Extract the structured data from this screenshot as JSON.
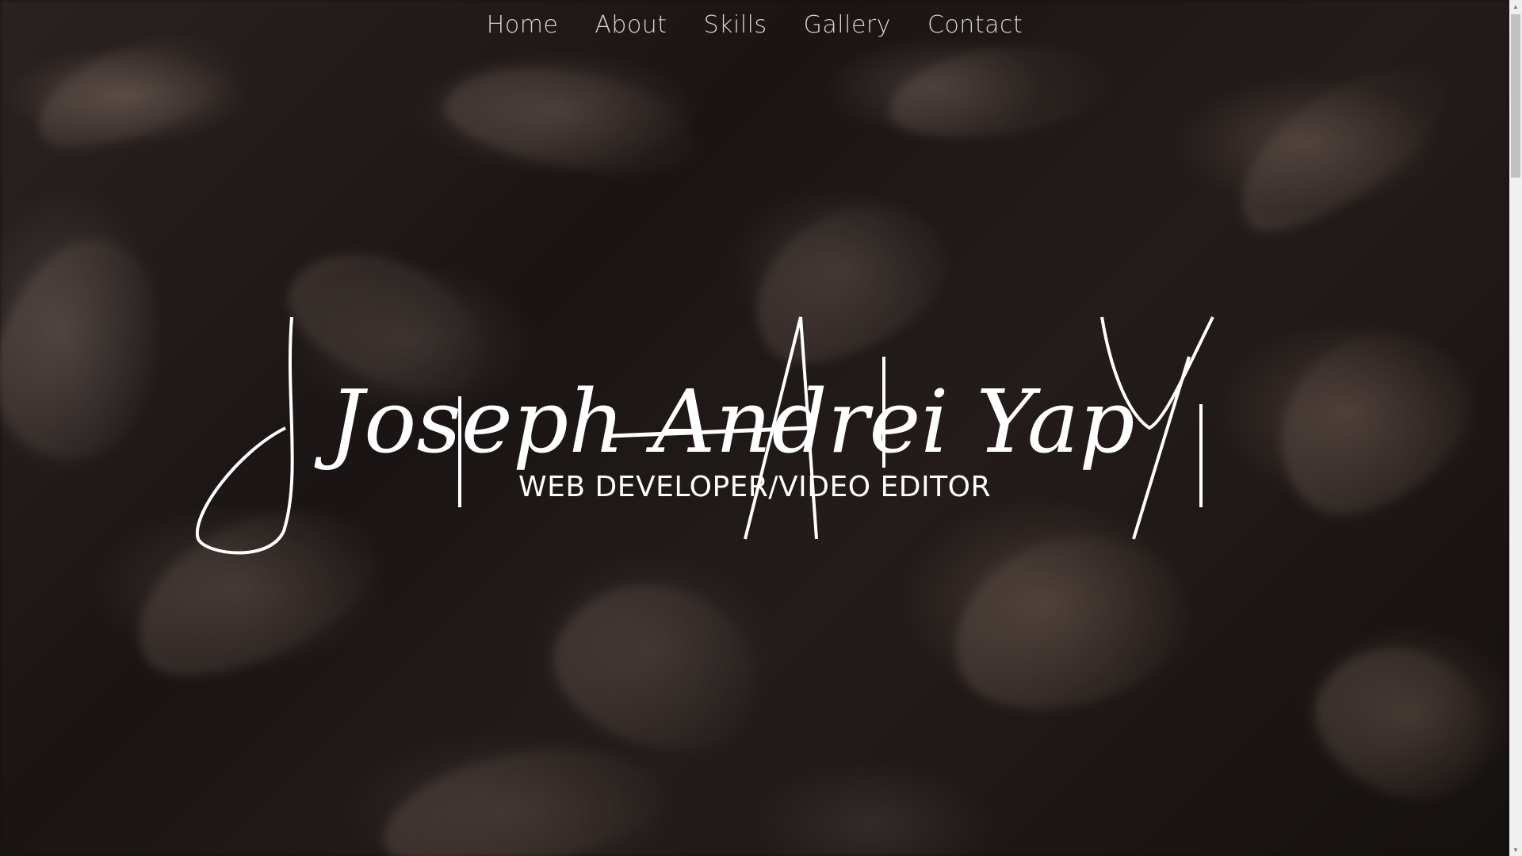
{
  "nav": {
    "items": [
      {
        "label": "Home"
      },
      {
        "label": "About"
      },
      {
        "label": "Skills"
      },
      {
        "label": "Gallery"
      },
      {
        "label": "Contact"
      }
    ]
  },
  "hero": {
    "name": "Joseph Andrei Yap",
    "subtitle": "WEB DEVELOPER/VIDEO EDITOR"
  },
  "scrollbar": {
    "up_icon": "chevron-up-icon",
    "down_icon": "chevron-down-icon",
    "position": 0
  },
  "colors": {
    "text": "#ffffff",
    "nav_text": "#d8d4d2",
    "background": "#1a1514"
  }
}
